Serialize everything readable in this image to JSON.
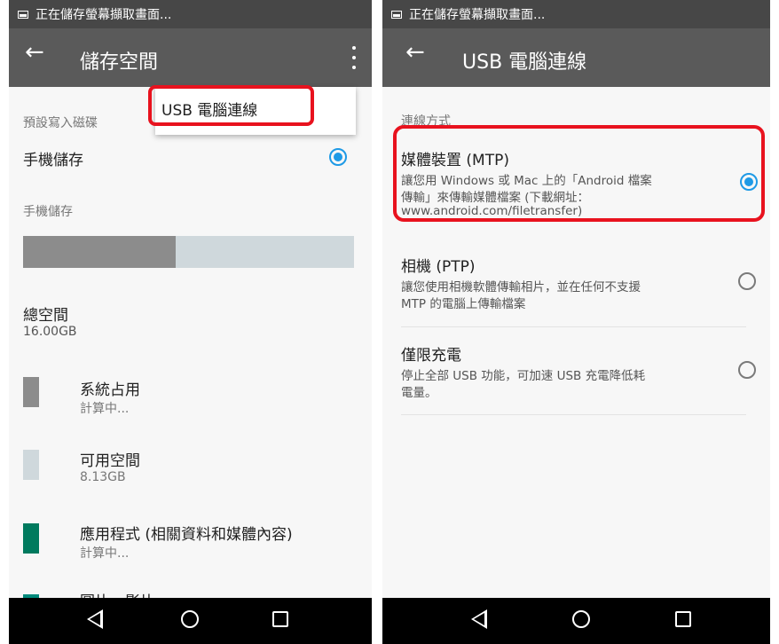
{
  "left": {
    "status_text": "正在儲存螢幕擷取畫面...",
    "title": "儲存空間",
    "popup": {
      "item": "USB 電腦連線"
    },
    "default_write_label": "預設寫入磁碟",
    "default_write_option": "手機儲存",
    "section_label": "手機儲存",
    "usage_bar": {
      "used_fraction": 0.46,
      "used_color": "#8c8c8c",
      "free_color": "#cfd8dc"
    },
    "total": {
      "label": "總空間",
      "value": "16.00GB"
    },
    "categories": [
      {
        "name": "系統占用",
        "value": "計算中...",
        "color": "#8c8c8c"
      },
      {
        "name": "可用空間",
        "value": "8.13GB",
        "color": "#cfd8dc"
      },
      {
        "name": "應用程式 (相關資料和媒體內容)",
        "value": "計算中...",
        "color": "#007a5e"
      },
      {
        "name": "圖片、影片",
        "value": "",
        "color": "#00897b"
      }
    ]
  },
  "right": {
    "status_text": "正在儲存螢幕擷取畫面...",
    "title": "USB 電腦連線",
    "section_label": "連線方式",
    "options": [
      {
        "title": "媒體裝置 (MTP)",
        "line1": "讓您用 Windows 或 Mac 上的「Android 檔案",
        "line2": "傳輸」來傳輸媒體檔案 (下載網址：",
        "line3": "www.android.com/filetransfer)",
        "selected": true
      },
      {
        "title": "相機 (PTP)",
        "line1": "讓您使用相機軟體傳輸相片，並在任何不支援",
        "line2": "MTP 的電腦上傳輸檔案",
        "selected": false
      },
      {
        "title": "僅限充電",
        "line1": "停止全部 USB 功能，可加速 USB 充電降低耗",
        "line2": "電量。",
        "selected": false
      }
    ]
  },
  "colors": {
    "highlight": "#e8121e",
    "accent": "#1e9ae6",
    "toolbar": "#5a5a5a",
    "statusbar": "#474747"
  },
  "icons": {
    "back": "arrow-left-icon",
    "more": "more-vert-icon",
    "nav": [
      "nav-back-icon",
      "nav-home-icon",
      "nav-recent-icon"
    ]
  }
}
